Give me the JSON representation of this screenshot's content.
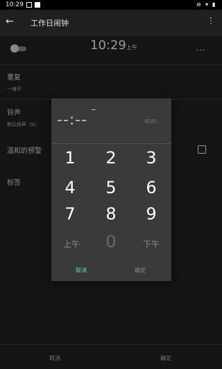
{
  "status_bar": {
    "time": "10:29"
  },
  "app_bar": {
    "title": "工作日闹钟"
  },
  "alarm": {
    "time": "10:29",
    "ampm": "上午",
    "more": "..."
  },
  "rows": {
    "repeat_label": "重复",
    "repeat_value": "一律不",
    "ringtone_label": "铃声",
    "ringtone_value": "默认铃声（S）",
    "gentle_label": "温和的预警",
    "tag_label": "标签"
  },
  "bottom": {
    "cancel": "取消",
    "ok": "确定"
  },
  "picker": {
    "top_dash": "_",
    "time_display": "--:--",
    "backspace": "4DEI",
    "keys": {
      "k1": "1",
      "k2": "2",
      "k3": "3",
      "k4": "4",
      "k5": "5",
      "k6": "6",
      "k7": "7",
      "k8": "8",
      "k9": "9",
      "am": "上午",
      "k0": "0",
      "pm": "下午"
    },
    "cancel": "取消",
    "ok": "确定"
  },
  "colors": {
    "accent": "#6ed0c3",
    "dialog_bg": "#3a3a3a",
    "background": "#141414"
  }
}
